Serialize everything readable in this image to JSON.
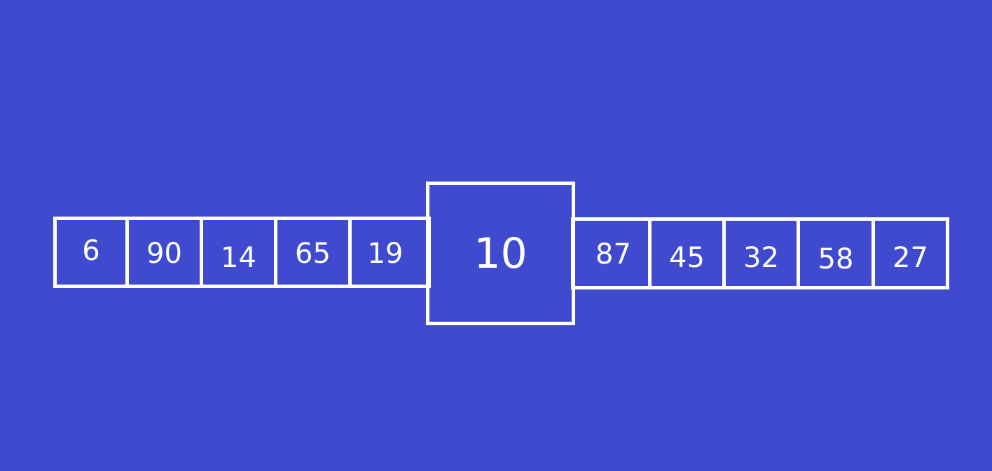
{
  "array": {
    "left_values": [
      "6",
      "90",
      "14",
      "65",
      "19"
    ],
    "highlight_value": "10",
    "right_values": [
      "87",
      "45",
      "32",
      "58",
      "27"
    ]
  },
  "colors": {
    "background": "#3f4ace",
    "stroke": "#ffffff",
    "text": "#ffffff"
  }
}
